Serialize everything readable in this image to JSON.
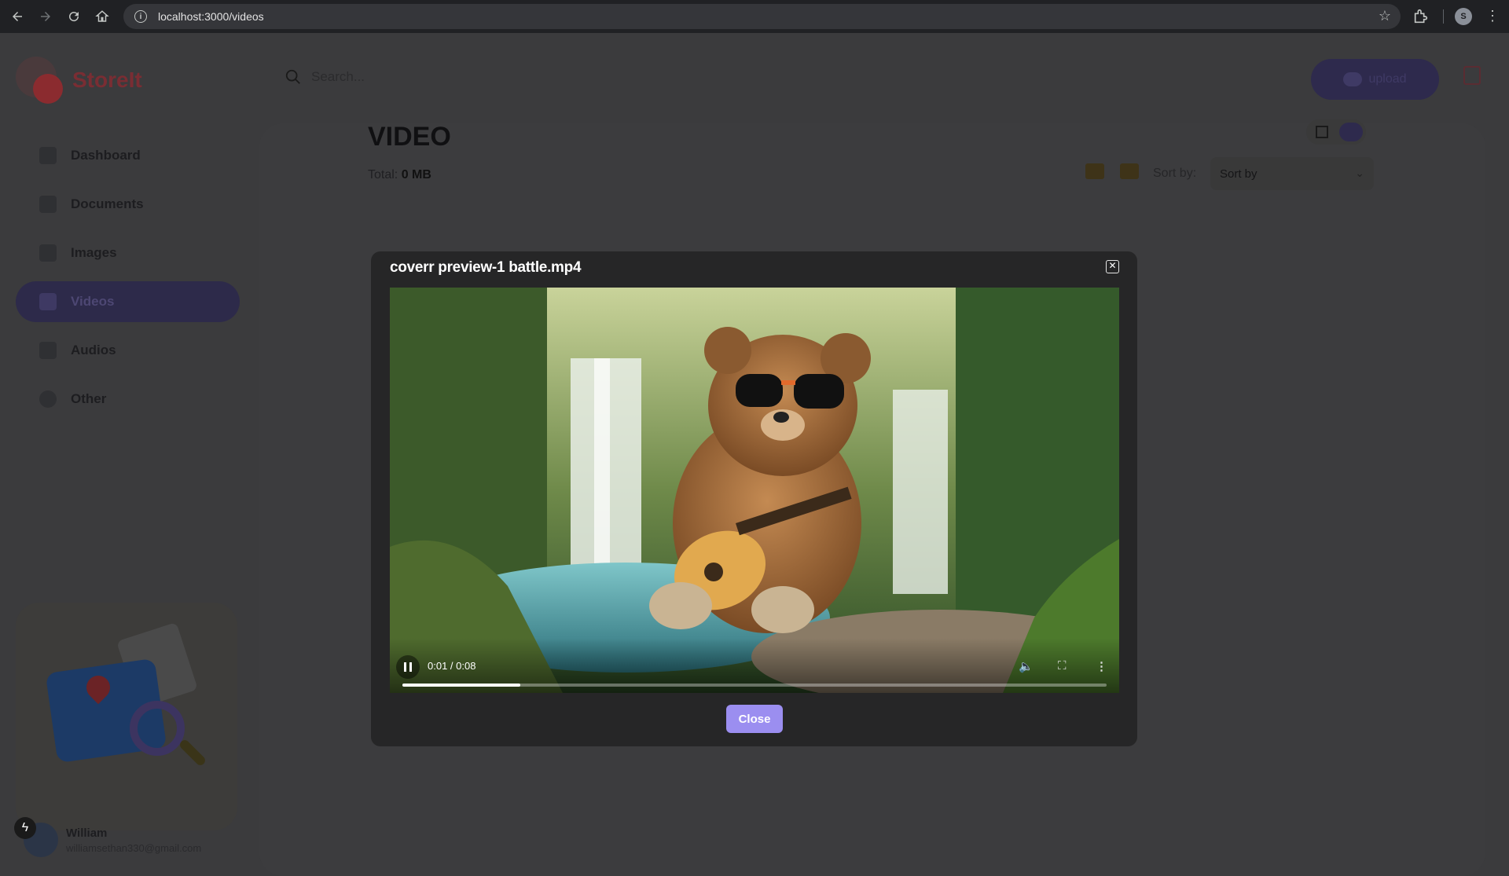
{
  "browser": {
    "url": "localhost:3000/videos",
    "profile_initial": "S"
  },
  "app": {
    "brand": "StoreIt",
    "search_placeholder": "Search...",
    "upload_label": "upload",
    "nav": [
      {
        "label": "Dashboard",
        "icon": "dashboard-icon"
      },
      {
        "label": "Documents",
        "icon": "document-icon"
      },
      {
        "label": "Images",
        "icon": "image-icon"
      },
      {
        "label": "Videos",
        "icon": "video-icon",
        "active": true
      },
      {
        "label": "Audios",
        "icon": "audio-icon"
      },
      {
        "label": "Other",
        "icon": "pie-chart-icon"
      }
    ],
    "user": {
      "name": "William",
      "email": "williamsethan330@gmail.com"
    }
  },
  "page": {
    "title": "VIDEO",
    "total_label": "Total:",
    "total_value": "0 MB",
    "sort_label": "Sort by:",
    "sort_value": "Sort by"
  },
  "modal": {
    "title": "coverr preview-1 battle.mp4",
    "close_label": "Close",
    "player": {
      "timecode": "0:01 / 0:08",
      "progress": 0.167,
      "state": "playing"
    }
  },
  "colors": {
    "accent": "#9b8ef0",
    "brand_red": "#e0393e",
    "active_nav": "#5b4fd1"
  }
}
